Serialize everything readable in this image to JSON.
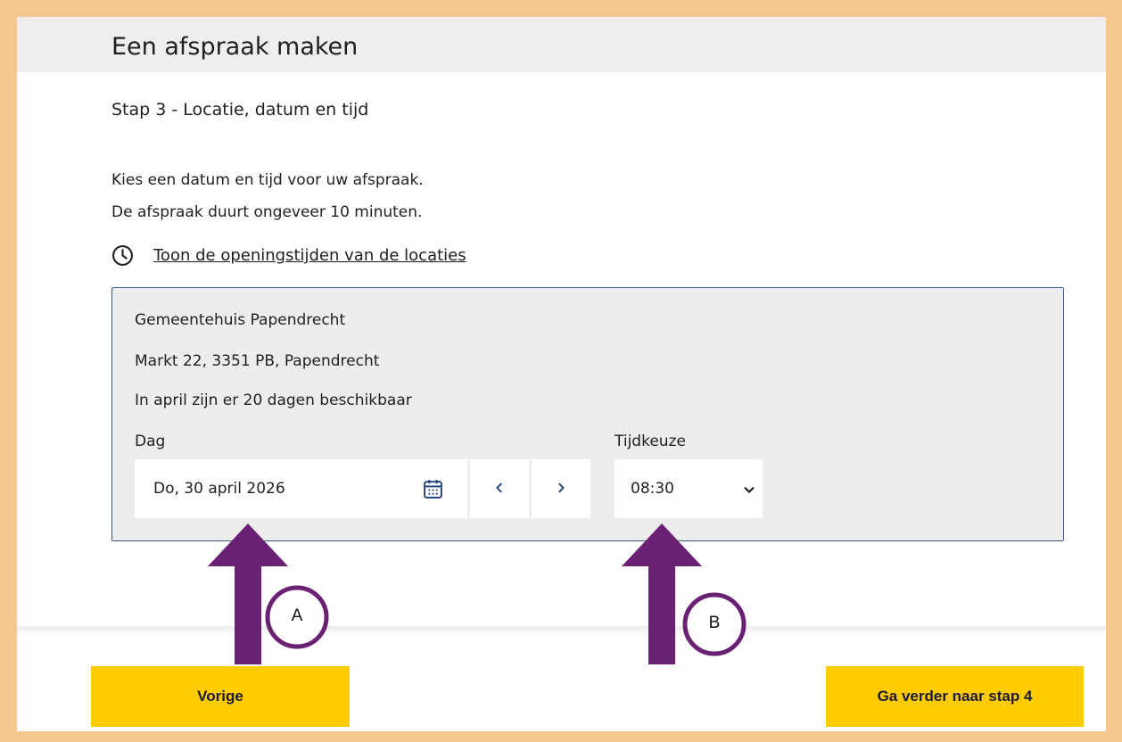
{
  "page": {
    "title": "Een afspraak maken",
    "step_title": "Stap 3 - Locatie, datum en tijd",
    "intro_line1": "Kies een datum en tijd voor uw afspraak.",
    "intro_line2": "De afspraak duurt ongeveer 10 minuten.",
    "hours_link": "Toon de openingstijden van de locaties"
  },
  "location": {
    "name": "Gemeentehuis Papendrecht",
    "address": "Markt 22, 3351 PB, Papendrecht",
    "availability": "In april zijn er 20 dagen beschikbaar",
    "day_label": "Dag",
    "day_value": "Do, 30 april 2026",
    "time_label": "Tijdkeuze",
    "time_value": "08:30"
  },
  "buttons": {
    "previous": "Vorige",
    "next": "Ga verder naar stap 4"
  },
  "annotations": {
    "a_label": "A",
    "b_label": "B"
  },
  "colors": {
    "border_frame": "#f6c88f",
    "header_band": "#eeeeee",
    "card_background": "#ededee",
    "card_border": "#3a5a8a",
    "button_yellow": "#ffcc00",
    "annotation_purple": "#6a2174",
    "link_blue": "#1b3e78"
  },
  "icons": {
    "clock": "clock-icon",
    "calendar": "calendar-icon",
    "prev": "chevron-left-icon",
    "next": "chevron-right-icon",
    "select": "chevron-down-icon"
  }
}
